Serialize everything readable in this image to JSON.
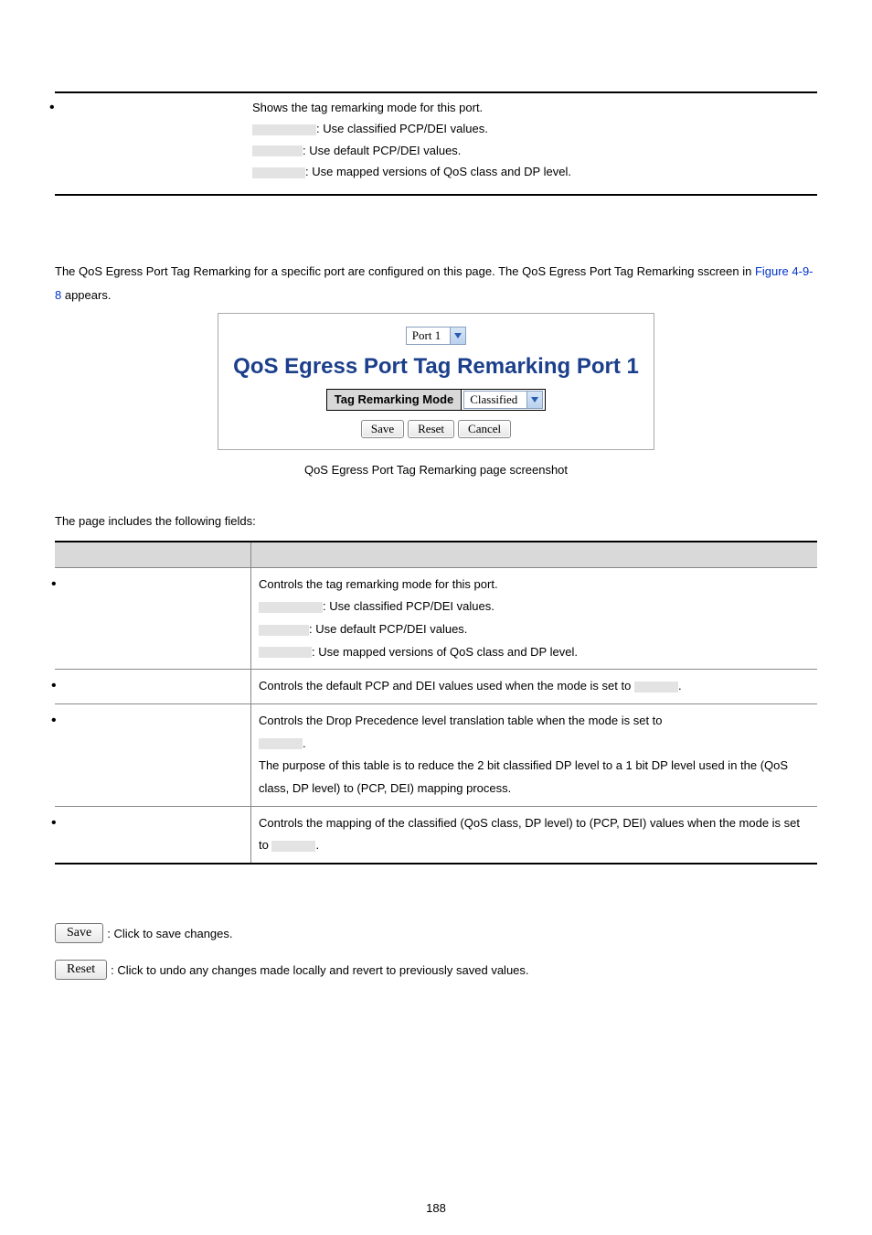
{
  "table1": {
    "desc_intro": "Shows the tag remarking mode for this port.",
    "line1": ": Use classified PCP/DEI values.",
    "line2": ": Use default PCP/DEI values.",
    "line3": ": Use mapped versions of QoS class and DP level."
  },
  "intro_para_1": "The QoS Egress Port Tag Remarking for a specific port are configured on this page. The QoS Egress Port Tag Remarking sscreen in ",
  "intro_link": "Figure 4-9-8",
  "intro_para_2": " appears.",
  "screenshot": {
    "port_label": "Port 1",
    "heading": "QoS Egress Port Tag Remarking  Port 1",
    "mode_label": "Tag Remarking Mode",
    "mode_value": "Classified",
    "btn_save": "Save",
    "btn_reset": "Reset",
    "btn_cancel": "Cancel"
  },
  "fig_caption": "QoS Egress Port Tag Remarking page screenshot",
  "fields_intro": "The page includes the following fields:",
  "t2": {
    "r1_intro": "Controls the tag remarking mode for this port.",
    "r1_l1": ": Use classified PCP/DEI values.",
    "r1_l2": ": Use default PCP/DEI values.",
    "r1_l3": ": Use mapped versions of QoS class and DP level.",
    "r2": "Controls the default PCP and DEI values used when the mode is set to ",
    "r2_end": ".",
    "r3_l1": "Controls the Drop Precedence level translation table when the mode is set to ",
    "r3_l1_end": ".",
    "r3_l2": "The purpose of this table is to reduce the 2 bit classified DP level to a 1 bit DP level used in the (QoS class, DP level) to (PCP, DEI) mapping process.",
    "r4_a": "Controls the mapping of the classified (QoS class, DP level) to (PCP, DEI) values when the mode is set to ",
    "r4_b": "."
  },
  "btn_save_label": "Save",
  "btn_save_text": ": Click to save changes.",
  "btn_reset_label": "Reset",
  "btn_reset_text": ": Click to undo any changes made locally and revert to previously saved values.",
  "page_number": "188"
}
